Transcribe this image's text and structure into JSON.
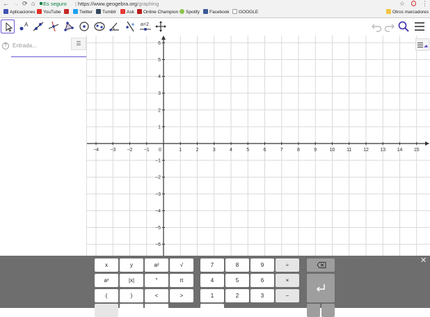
{
  "browser": {
    "secure_label": "Es seguro",
    "url_domain": "https://www.geogebra.org",
    "url_path": "/graphing",
    "icons": [
      "back-icon",
      "forward-icon",
      "reload-icon",
      "home-icon",
      "star-icon",
      "opera-icon",
      "menu-icon"
    ]
  },
  "bookmarks": {
    "items": [
      {
        "label": "Aplicaciones",
        "icon": "apps-icon",
        "color": "#3f51b5"
      },
      {
        "label": "YouTube",
        "icon": "youtube-icon",
        "color": "#e52d27"
      },
      {
        "label": "",
        "icon": "flag-icon",
        "color": "#c62828"
      },
      {
        "label": "Twitter",
        "icon": "twitter-icon",
        "color": "#1da1f2"
      },
      {
        "label": "Tumblr",
        "icon": "tumblr-icon",
        "color": "#35465c"
      },
      {
        "label": "Ask",
        "icon": "ask-icon",
        "color": "#e53935"
      },
      {
        "label": "Online Champion",
        "icon": "online-champion-icon",
        "color": "#b71c1c"
      },
      {
        "label": "Spotify",
        "icon": "spotify-icon",
        "color": "#8bc34a"
      },
      {
        "label": "Facebook",
        "icon": "facebook-icon",
        "color": "#3b5998"
      },
      {
        "label": "GOOGLE",
        "icon": "page-icon",
        "color": "#9e9e9e"
      }
    ],
    "other": "Otros marcadores"
  },
  "toolbar": {
    "tools": [
      {
        "name": "move-tool"
      },
      {
        "name": "point-tool"
      },
      {
        "name": "line-tool"
      },
      {
        "name": "perpendicular-tool"
      },
      {
        "name": "polygon-tool"
      },
      {
        "name": "circle-tool"
      },
      {
        "name": "ellipse-tool"
      },
      {
        "name": "angle-tool"
      },
      {
        "name": "reflect-tool"
      },
      {
        "name": "slider-tool",
        "label": "a=2"
      },
      {
        "name": "move-graphics-tool"
      }
    ],
    "right_icons": [
      "undo-icon",
      "redo-icon",
      "search-icon",
      "menu-icon"
    ]
  },
  "algebra": {
    "placeholder": "Entrada..."
  },
  "axes": {
    "x": {
      "min": -4,
      "max": 15
    },
    "y": {
      "min": -6,
      "max": 6
    },
    "x_labels": [
      "−4",
      "−3",
      "−2",
      "−1",
      "0",
      "1",
      "2",
      "3",
      "4",
      "5",
      "6",
      "7",
      "8",
      "9",
      "10",
      "11",
      "12",
      "13",
      "14",
      "15"
    ],
    "y_labels": [
      "6",
      "5",
      "4",
      "3",
      "2",
      "1",
      "0",
      "−1",
      "−2",
      "−3",
      "−4",
      "−5",
      "−6"
    ],
    "grid": true,
    "grid_color": "#d9d9d9",
    "axis_color": "#333333"
  },
  "keyboard": {
    "rows": [
      [
        "x",
        "y",
        "a²",
        "√",
        "7",
        "8",
        "9",
        "÷"
      ],
      [
        "aˣ",
        "|x|",
        "°",
        "π",
        "4",
        "5",
        "6",
        "×"
      ],
      [
        "(",
        ")",
        "<",
        ">",
        "1",
        "2",
        "3",
        "−"
      ]
    ],
    "enter_icon": "enter-icon",
    "backspace_icon": "backspace-icon",
    "close_icon": "close-icon"
  }
}
